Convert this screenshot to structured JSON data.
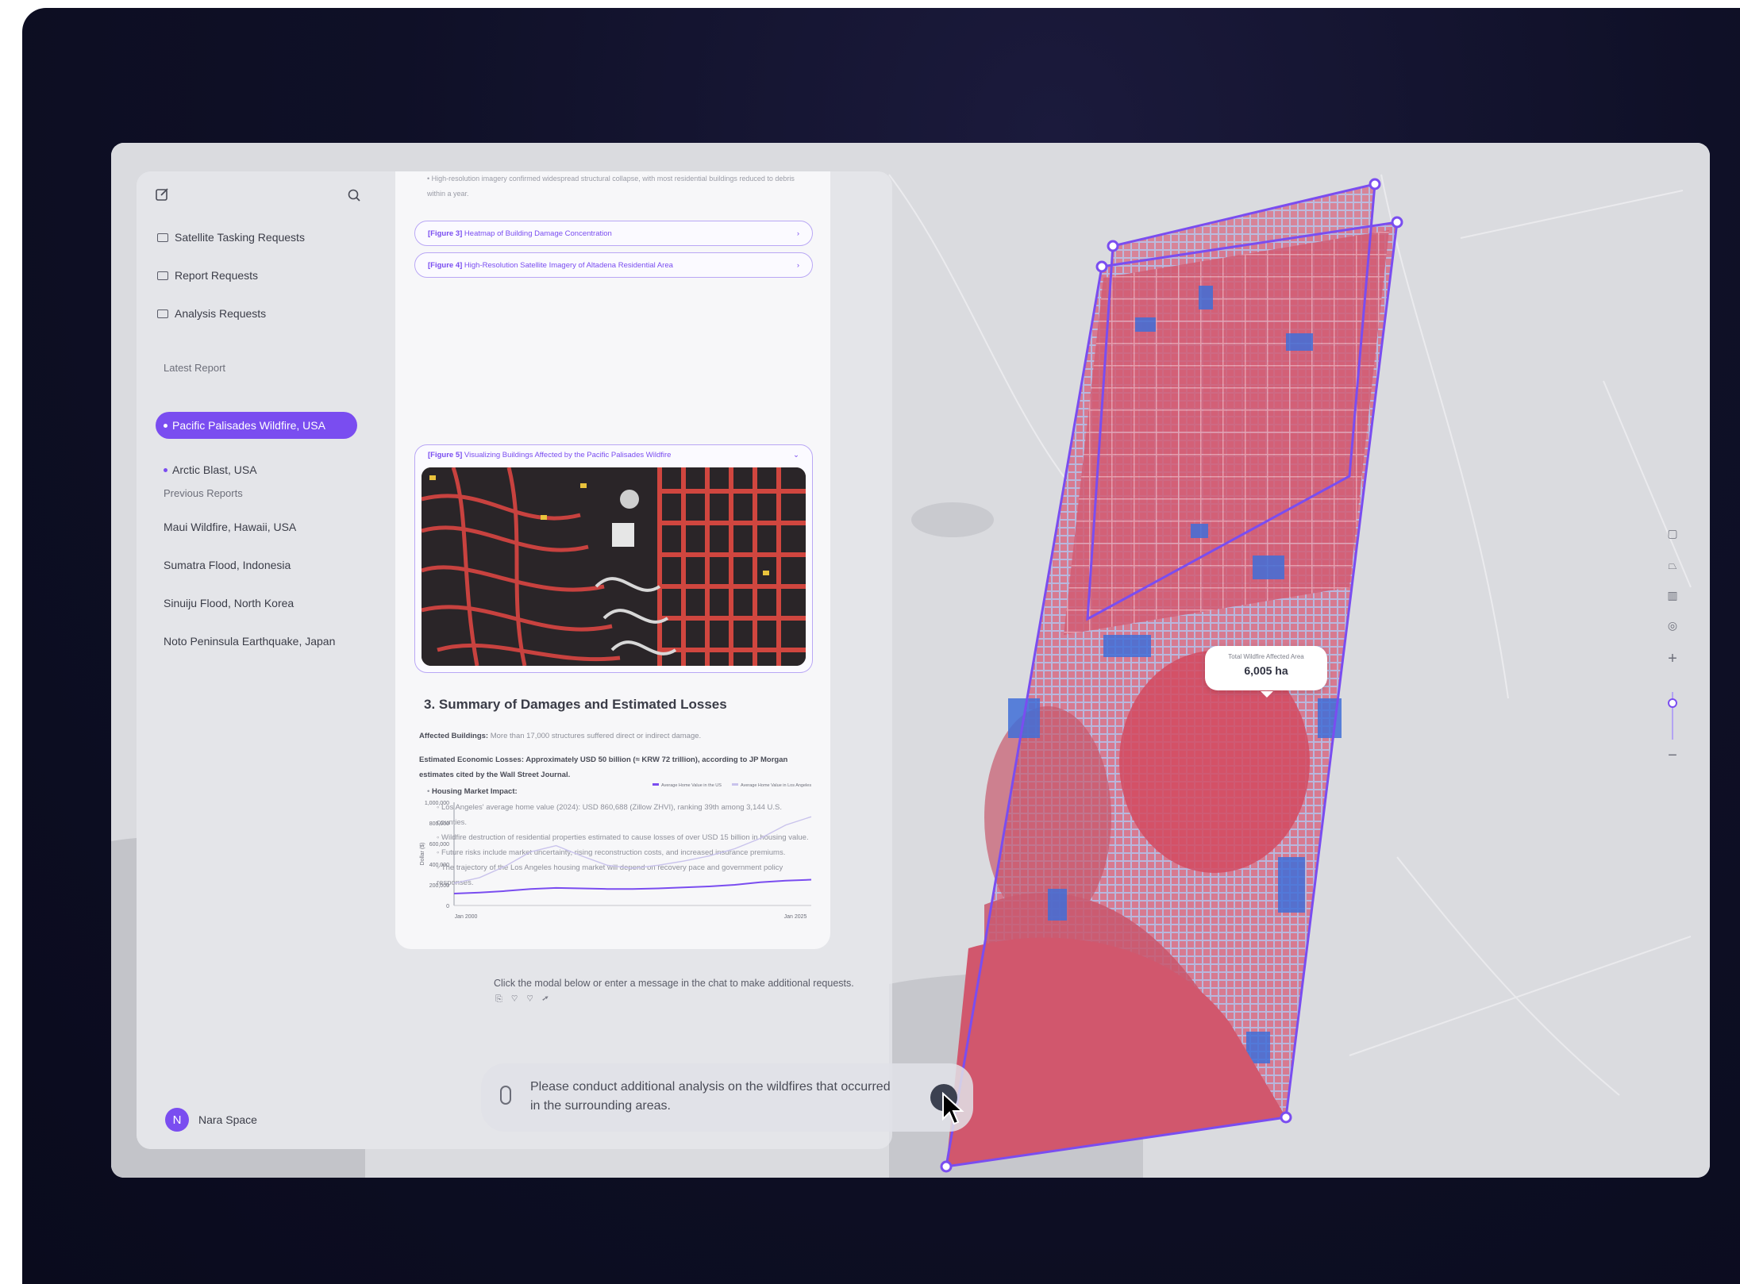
{
  "sidebar": {
    "items": [
      {
        "label": "Satellite Tasking Requests"
      },
      {
        "label": "Report Requests"
      },
      {
        "label": "Analysis Requests"
      }
    ],
    "latest_heading": "Latest Report",
    "latest": [
      {
        "label": "Pacific Palisades Wildfire, USA",
        "active": true
      },
      {
        "label": "Arctic Blast, USA",
        "active": false
      }
    ],
    "previous_heading": "Previous Reports",
    "previous": [
      {
        "label": "Maui Wildfire, Hawaii, USA"
      },
      {
        "label": "Sumatra Flood, Indonesia"
      },
      {
        "label": "Sinuiju Flood, North Korea"
      },
      {
        "label": "Noto Peninsula Earthquake, Japan"
      }
    ],
    "user": {
      "initial": "N",
      "name": "Nara Space"
    }
  },
  "report": {
    "intro_bullet": "High-resolution imagery confirmed widespread structural collapse, with most residential buildings reduced to debris within a year.",
    "figures": [
      {
        "tag": "[Figure 3]",
        "title": "Heatmap of Building Damage Concentration"
      },
      {
        "tag": "[Figure 4]",
        "title": "High-Resolution Satellite Imagery of Altadena Residential Area"
      },
      {
        "tag": "[Figure 5]",
        "title": "Visualizing Buildings Affected by the Pacific Palisades Wildfire"
      }
    ],
    "section_title": "3. Summary of Damages and Estimated Losses",
    "affected_label": "Affected Buildings:",
    "affected_text": "More than 17,000 structures suffered direct or indirect damage.",
    "economic_text": "Estimated Economic Losses: Approximately USD 50 billion (≈ KRW 72 trillion), according to JP Morgan estimates cited by the Wall Street Journal.",
    "housing_heading": "Housing Market Impact:",
    "housing_points": [
      "Los Angeles' average home value (2024): USD 860,688 (Zillow ZHVI), ranking 39th among 3,144 U.S. counties.",
      "Wildfire destruction of residential properties estimated to cause losses of over USD 15 billion in housing value.",
      "Future risks include market uncertainty, rising reconstruction costs, and increased insurance premiums.",
      "The trajectory of the Los Angeles housing market will depend on recovery pace and government policy responses."
    ]
  },
  "chart_data": {
    "type": "line",
    "title": "",
    "xlabel": "",
    "ylabel": "Dollar ($)",
    "x_ticks": [
      "Jan 2000",
      "Jan 2025"
    ],
    "y_ticks": [
      "1,000,000",
      "800,000",
      "600,000",
      "400,000",
      "200,000",
      "0"
    ],
    "ylim": [
      0,
      1000000
    ],
    "legend_position": "top-right",
    "series": [
      {
        "name": "Average Home Value in the US",
        "color": "#7a4df0",
        "values": [
          115000,
          125000,
          140000,
          160000,
          170000,
          165000,
          160000,
          160000,
          165000,
          175000,
          185000,
          200000,
          225000,
          240000,
          250000
        ]
      },
      {
        "name": "Average Home Value in Los Angeles",
        "color": "#c9c3ec",
        "values": [
          215000,
          270000,
          380000,
          520000,
          580000,
          480000,
          390000,
          360000,
          390000,
          430000,
          480000,
          550000,
          650000,
          780000,
          860000
        ]
      }
    ]
  },
  "chat": {
    "hint": "Click the modal below or enter a message in the chat to make additional requests.",
    "hint_icons": "⎘ ♡ ♡ ➚",
    "message": "Please conduct additional analysis on the wildfires that occurred in the surrounding areas."
  },
  "map": {
    "tooltip_label": "Total Wildfire Affected Area",
    "tooltip_value": "6,005 ha",
    "colors": {
      "burned": "#d9495f",
      "unburned": "#3f6fd8",
      "outline": "#7a4df0"
    }
  }
}
